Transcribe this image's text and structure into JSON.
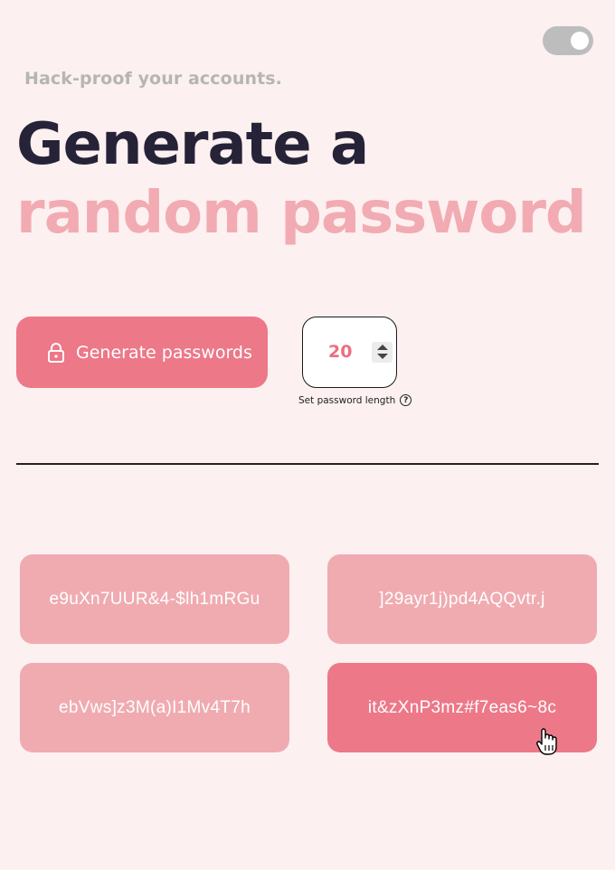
{
  "header": {
    "tagline": "Hack-proof your accounts.",
    "headline_line1": "Generate a",
    "headline_line2": "random password",
    "theme_toggle_state": "on"
  },
  "controls": {
    "generate_button_label": "Generate passwords",
    "length_value": "20",
    "length_caption": "Set password length",
    "help_icon_glyph": "?"
  },
  "passwords": [
    "e9uXn7UUR&4-$lh1mRGu",
    "]29ayr1j)pd4AQQvtr.j",
    "ebVws]z3M(a)I1Mv4T7h",
    "it&zXnP3mz#f7eas6~8c"
  ],
  "colors": {
    "background": "#fcf0f0",
    "accent": "#ed7888",
    "accent_light": "#f0abb1",
    "headline_dark": "#262338",
    "headline_pink": "#f2abb2"
  },
  "icons": {
    "generate_button_icon": "lock-icon",
    "cursor": "hand-pointer-icon"
  }
}
